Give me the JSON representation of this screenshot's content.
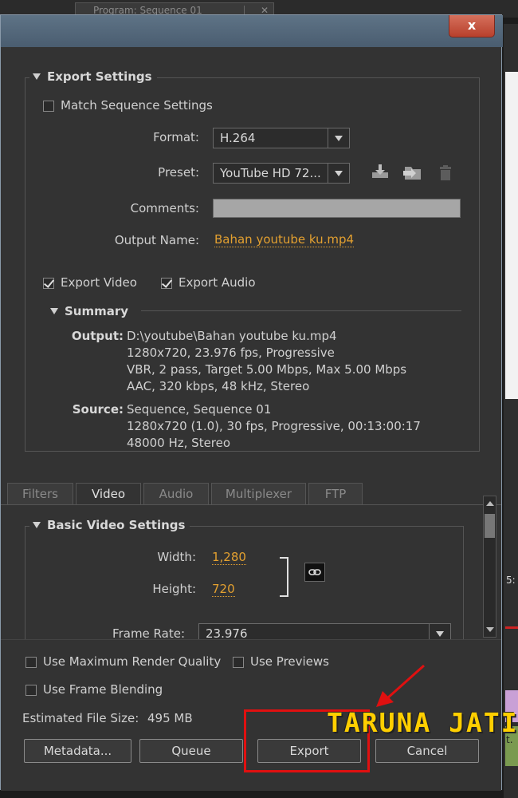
{
  "background": {
    "top_tab": "Program: Sequence 01",
    "right_fragment_1": "5:",
    "right_fragment_2": "t."
  },
  "window": {
    "close_glyph": "x"
  },
  "export_settings": {
    "header": "Export Settings",
    "match_sequence": {
      "label": "Match Sequence Settings",
      "checked": false
    },
    "format": {
      "label": "Format:",
      "value": "H.264"
    },
    "preset": {
      "label": "Preset:",
      "value": "YouTube HD 72..."
    },
    "comments": {
      "label": "Comments:",
      "value": ""
    },
    "output_name": {
      "label": "Output Name:",
      "value": "Bahan youtube ku.mp4"
    },
    "export_video": {
      "label": "Export Video",
      "checked": true
    },
    "export_audio": {
      "label": "Export Audio",
      "checked": true
    },
    "preset_icons": [
      "save-preset-icon",
      "import-preset-icon",
      "delete-preset-icon"
    ]
  },
  "summary": {
    "header": "Summary",
    "output_label": "Output:",
    "output_lines": [
      "D:\\youtube\\Bahan youtube ku.mp4",
      "1280x720, 23.976 fps, Progressive",
      "VBR, 2 pass, Target 5.00 Mbps, Max 5.00 Mbps",
      "AAC, 320 kbps, 48 kHz, Stereo"
    ],
    "source_label": "Source:",
    "source_lines": [
      "Sequence, Sequence 01",
      "1280x720 (1.0), 30 fps, Progressive, 00:13:00:17",
      "48000 Hz, Stereo"
    ]
  },
  "tabs": [
    {
      "label": "Filters",
      "active": false
    },
    {
      "label": "Video",
      "active": true
    },
    {
      "label": "Audio",
      "active": false
    },
    {
      "label": "Multiplexer",
      "active": false
    },
    {
      "label": "FTP",
      "active": false
    }
  ],
  "video_settings": {
    "header": "Basic Video Settings",
    "width": {
      "label": "Width:",
      "value": "1,280"
    },
    "height": {
      "label": "Height:",
      "value": "720"
    },
    "frame_rate": {
      "label": "Frame Rate:",
      "value": "23.976"
    },
    "link_icon": "link-icon"
  },
  "bottom": {
    "max_render_quality": {
      "label": "Use Maximum Render Quality",
      "checked": false
    },
    "use_previews": {
      "label": "Use Previews",
      "checked": false
    },
    "frame_blending": {
      "label": "Use Frame Blending",
      "checked": false
    },
    "file_size_label": "Estimated File Size:",
    "file_size_value": "495 MB",
    "buttons": {
      "metadata": "Metadata...",
      "queue": "Queue",
      "export": "Export",
      "cancel": "Cancel"
    }
  },
  "watermark": "TARUNA JATI",
  "colors": {
    "link": "#e3a030",
    "annotation": "#e01010",
    "watermark": "#ffcf00",
    "panel": "#333333"
  }
}
